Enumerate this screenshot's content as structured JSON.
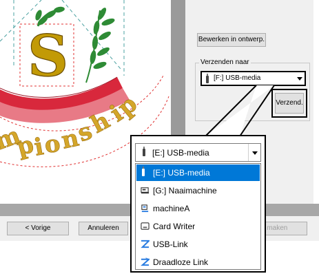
{
  "canvas": {
    "design_letter": "S",
    "arc_text": "mpionship"
  },
  "right_panel": {
    "edit_button": "Bewerken in ontwerp.",
    "group_label": "Verzenden naar",
    "selected_drive": "[F:] USB-media",
    "send_button": "Verzend."
  },
  "bottom": {
    "prev_button": "< Vorige",
    "cancel_button": "Annuleren",
    "make_button_partial": "p maken"
  },
  "popup": {
    "combo_value": "[E:] USB-media",
    "options": [
      {
        "label": "[E:] USB-media",
        "icon": "usb-drive-icon",
        "selected": true
      },
      {
        "label": "[G:] Naaimachine",
        "icon": "sewing-machine-icon",
        "selected": false
      },
      {
        "label": "machineA",
        "icon": "network-machine-icon",
        "selected": false
      },
      {
        "label": "Card Writer",
        "icon": "card-writer-icon",
        "selected": false
      },
      {
        "label": "USB-Link",
        "icon": "usb-link-icon",
        "selected": false
      },
      {
        "label": "Draadloze Link",
        "icon": "wireless-link-icon",
        "selected": false
      }
    ]
  },
  "colors": {
    "selection": "#0078d7",
    "gold": "#c29a06",
    "red": "#d8283c",
    "green": "#2e8b35"
  }
}
